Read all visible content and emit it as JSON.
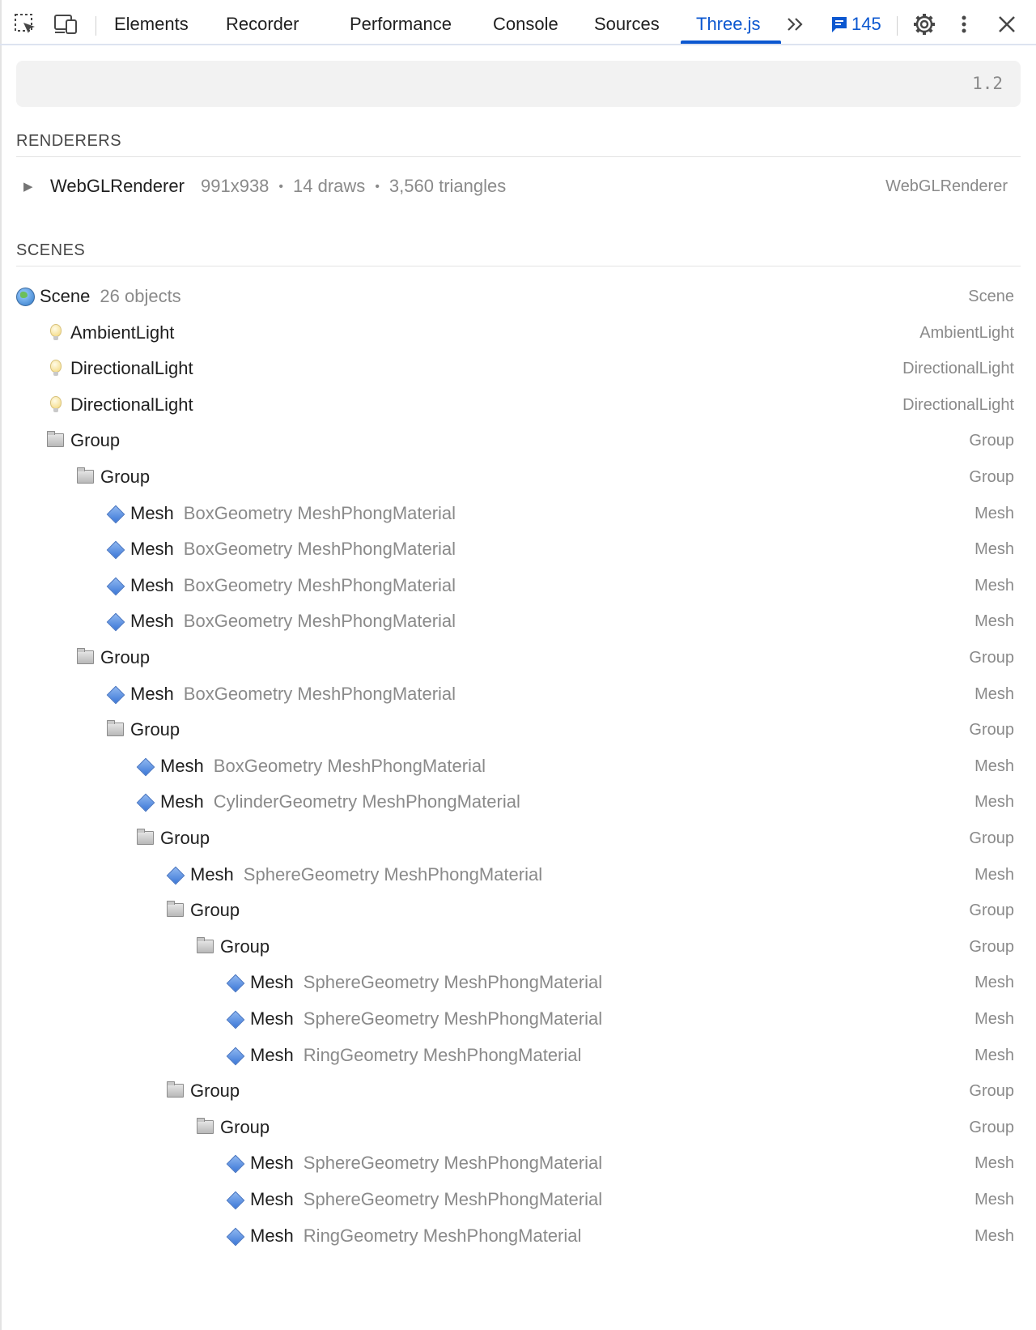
{
  "toolbar": {
    "tabs": [
      {
        "label": "Elements"
      },
      {
        "label": "Recorder"
      },
      {
        "label": "Performance"
      },
      {
        "label": "Console"
      },
      {
        "label": "Sources"
      },
      {
        "label": "Three.js"
      }
    ],
    "active_tab": "Three.js",
    "issues_count": "145",
    "accent_color": "#0b57d0"
  },
  "header": {
    "version": "1.2"
  },
  "renderers": {
    "title": "RENDERERS",
    "items": [
      {
        "name": "WebGLRenderer",
        "size": "991x938",
        "draws": "14 draws",
        "triangles": "3,560 triangles",
        "type": "WebGLRenderer"
      }
    ]
  },
  "scenes": {
    "title": "SCENES",
    "tree": [
      {
        "icon": "globe",
        "name": "Scene",
        "detail": "26 objects",
        "type": "Scene",
        "depth": 0
      },
      {
        "icon": "bulb",
        "name": "AmbientLight",
        "detail": "",
        "type": "AmbientLight",
        "depth": 1
      },
      {
        "icon": "bulb",
        "name": "DirectionalLight",
        "detail": "",
        "type": "DirectionalLight",
        "depth": 1
      },
      {
        "icon": "bulb",
        "name": "DirectionalLight",
        "detail": "",
        "type": "DirectionalLight",
        "depth": 1
      },
      {
        "icon": "folder",
        "name": "Group",
        "detail": "",
        "type": "Group",
        "depth": 1
      },
      {
        "icon": "folder",
        "name": "Group",
        "detail": "",
        "type": "Group",
        "depth": 2
      },
      {
        "icon": "diamond",
        "name": "Mesh",
        "detail": "BoxGeometry MeshPhongMaterial",
        "type": "Mesh",
        "depth": 3
      },
      {
        "icon": "diamond",
        "name": "Mesh",
        "detail": "BoxGeometry MeshPhongMaterial",
        "type": "Mesh",
        "depth": 3
      },
      {
        "icon": "diamond",
        "name": "Mesh",
        "detail": "BoxGeometry MeshPhongMaterial",
        "type": "Mesh",
        "depth": 3
      },
      {
        "icon": "diamond",
        "name": "Mesh",
        "detail": "BoxGeometry MeshPhongMaterial",
        "type": "Mesh",
        "depth": 3
      },
      {
        "icon": "folder",
        "name": "Group",
        "detail": "",
        "type": "Group",
        "depth": 2
      },
      {
        "icon": "diamond",
        "name": "Mesh",
        "detail": "BoxGeometry MeshPhongMaterial",
        "type": "Mesh",
        "depth": 3
      },
      {
        "icon": "folder",
        "name": "Group",
        "detail": "",
        "type": "Group",
        "depth": 3
      },
      {
        "icon": "diamond",
        "name": "Mesh",
        "detail": "BoxGeometry MeshPhongMaterial",
        "type": "Mesh",
        "depth": 4
      },
      {
        "icon": "diamond",
        "name": "Mesh",
        "detail": "CylinderGeometry MeshPhongMaterial",
        "type": "Mesh",
        "depth": 4
      },
      {
        "icon": "folder",
        "name": "Group",
        "detail": "",
        "type": "Group",
        "depth": 4
      },
      {
        "icon": "diamond",
        "name": "Mesh",
        "detail": "SphereGeometry MeshPhongMaterial",
        "type": "Mesh",
        "depth": 5
      },
      {
        "icon": "folder",
        "name": "Group",
        "detail": "",
        "type": "Group",
        "depth": 5
      },
      {
        "icon": "folder",
        "name": "Group",
        "detail": "",
        "type": "Group",
        "depth": 6
      },
      {
        "icon": "diamond",
        "name": "Mesh",
        "detail": "SphereGeometry MeshPhongMaterial",
        "type": "Mesh",
        "depth": 7
      },
      {
        "icon": "diamond",
        "name": "Mesh",
        "detail": "SphereGeometry MeshPhongMaterial",
        "type": "Mesh",
        "depth": 7
      },
      {
        "icon": "diamond",
        "name": "Mesh",
        "detail": "RingGeometry MeshPhongMaterial",
        "type": "Mesh",
        "depth": 7
      },
      {
        "icon": "folder",
        "name": "Group",
        "detail": "",
        "type": "Group",
        "depth": 5
      },
      {
        "icon": "folder",
        "name": "Group",
        "detail": "",
        "type": "Group",
        "depth": 6
      },
      {
        "icon": "diamond",
        "name": "Mesh",
        "detail": "SphereGeometry MeshPhongMaterial",
        "type": "Mesh",
        "depth": 7
      },
      {
        "icon": "diamond",
        "name": "Mesh",
        "detail": "SphereGeometry MeshPhongMaterial",
        "type": "Mesh",
        "depth": 7
      },
      {
        "icon": "diamond",
        "name": "Mesh",
        "detail": "RingGeometry MeshPhongMaterial",
        "type": "Mesh",
        "depth": 7
      }
    ]
  }
}
